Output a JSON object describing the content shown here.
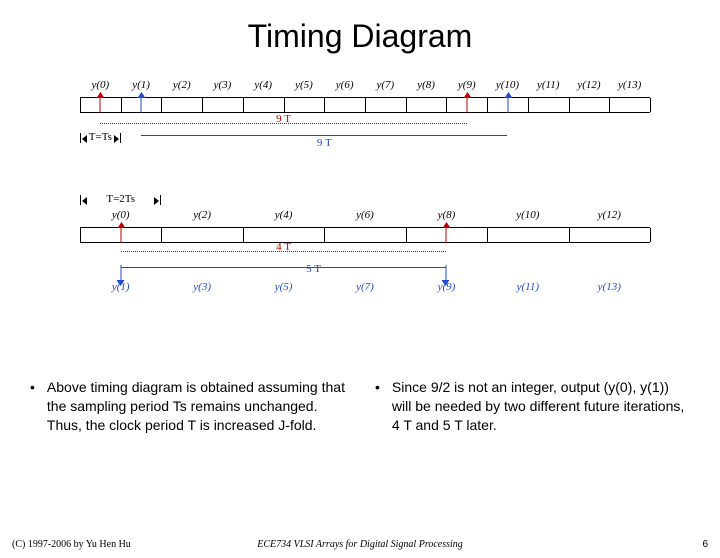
{
  "title": "Timing Diagram",
  "top": {
    "labels": [
      "y(0)",
      "y(1)",
      "y(2)",
      "y(3)",
      "y(4)",
      "y(5)",
      "y(6)",
      "y(7)",
      "y(8)",
      "y(9)",
      "y(10)",
      "y(11)",
      "y(12)",
      "y(13)"
    ],
    "span9a": "9 T",
    "span9b": "9 T",
    "t_ts": "T=Ts"
  },
  "mid": {
    "t_2ts": "T=2Ts",
    "labels_even": [
      "y(0)",
      "y(2)",
      "y(4)",
      "y(6)",
      "y(8)",
      "y(10)",
      "y(12)"
    ],
    "labels_odd": [
      "y(1)",
      "y(3)",
      "y(5)",
      "y(7)",
      "y(9)",
      "y(11)",
      "y(13)"
    ],
    "span4": "4 T",
    "span5": "5 T"
  },
  "bullets": {
    "left": "Above timing diagram is obtained assuming that the sampling period Ts remains unchanged. Thus, the clock period T is increased J-fold.",
    "right": "Since 9/2 is not an integer, output (y(0), y(1)) will be needed by two different future iterations, 4 T and 5 T later."
  },
  "footer": {
    "left": "(C) 1997-2006 by Yu Hen Hu",
    "center": "ECE734 VLSI Arrays for Digital Signal Processing",
    "page": "6"
  },
  "chart_data": {
    "type": "table",
    "description": "Two timing diagrams illustrating dependency spans",
    "top_sequence": {
      "period": "T=Ts",
      "outputs": [
        0,
        1,
        2,
        3,
        4,
        5,
        6,
        7,
        8,
        9,
        10,
        11,
        12,
        13
      ],
      "dependency_spans": [
        {
          "from": "y(0)",
          "to": "y(9)",
          "length": 9
        },
        {
          "from": "y(1)",
          "to": "y(10)",
          "length": 9
        }
      ]
    },
    "bottom_sequence": {
      "period": "T=2Ts",
      "even_outputs": [
        0,
        2,
        4,
        6,
        8,
        10,
        12
      ],
      "odd_outputs": [
        1,
        3,
        5,
        7,
        9,
        11,
        13
      ],
      "dependency_spans": [
        {
          "from": "y(0)",
          "to_even": "y(8)",
          "length": 4,
          "label": "4 T"
        },
        {
          "from": "y(0)",
          "to_odd": "y(9)",
          "length": 5,
          "label": "5 T"
        }
      ]
    }
  }
}
